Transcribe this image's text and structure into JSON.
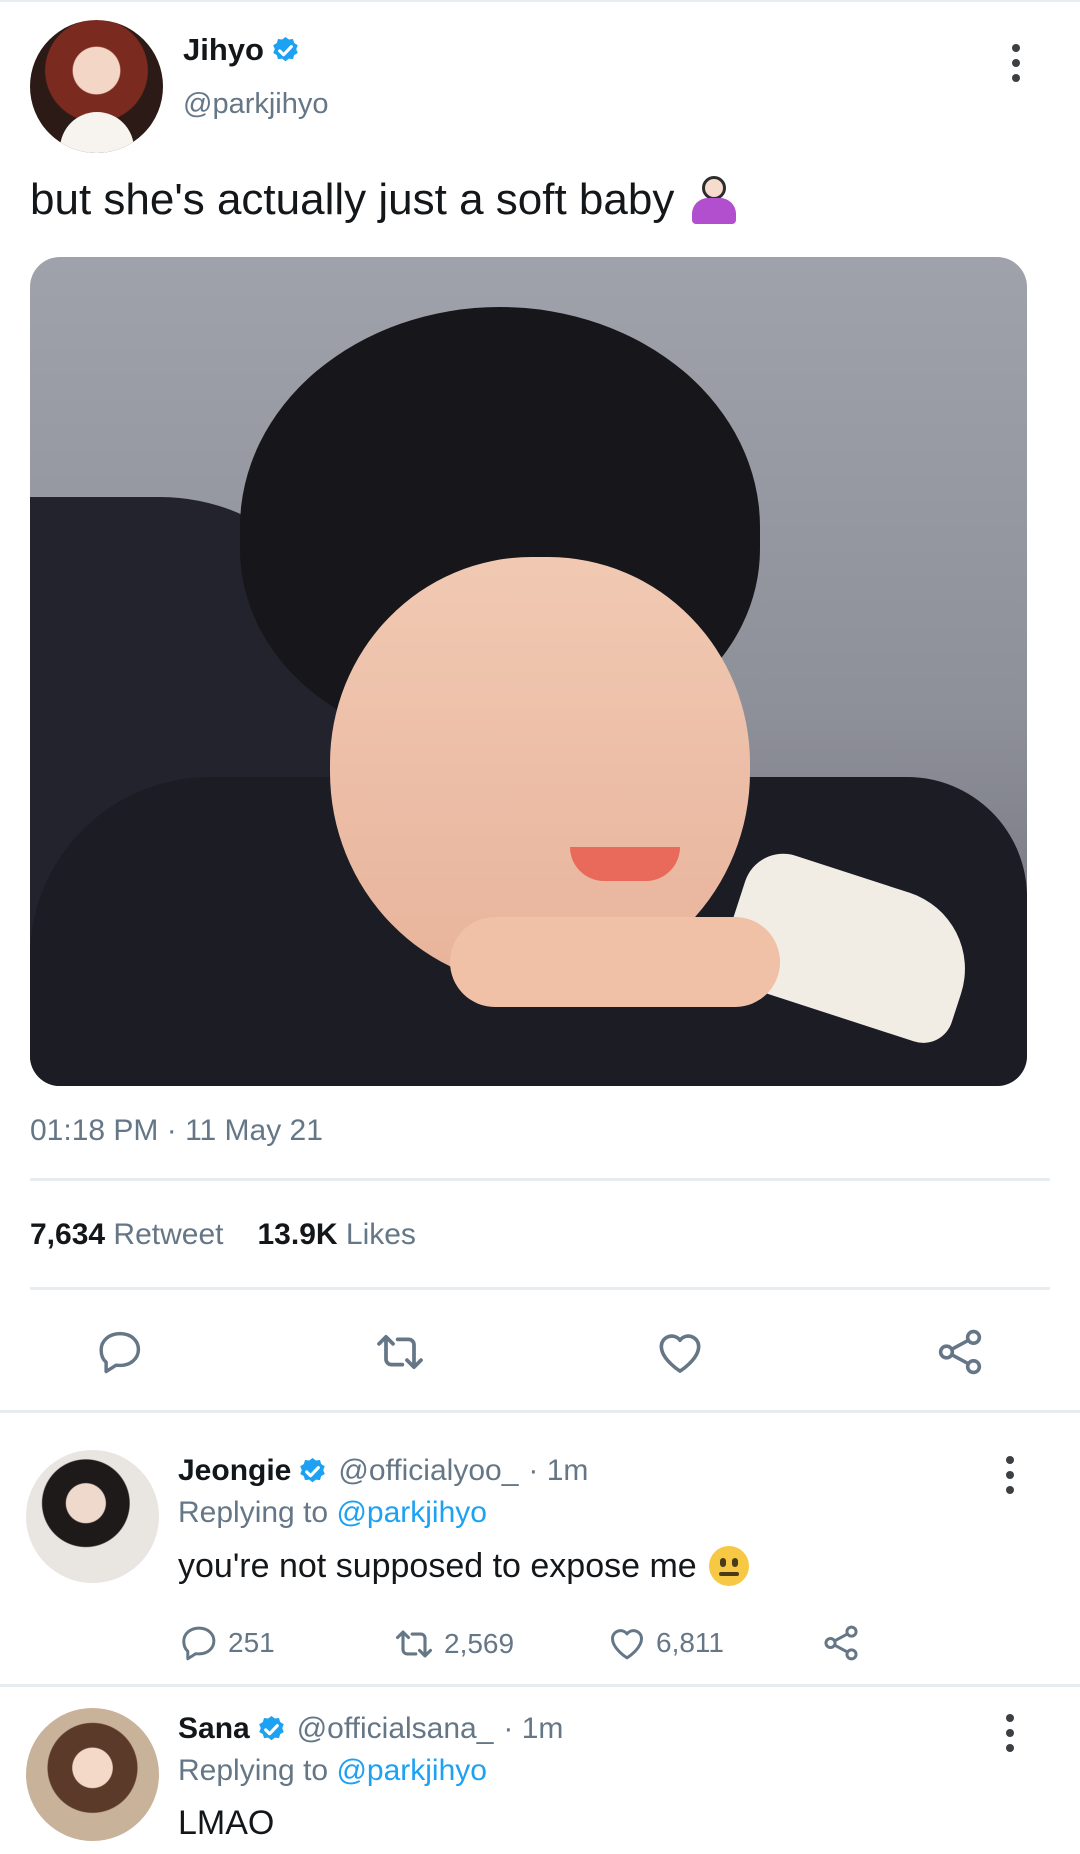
{
  "tweet": {
    "author_name": "Jihyo",
    "author_handle": "@parkjihyo",
    "text": "but she's actually just a soft baby",
    "emoji_icon": "person-shrugging-icon",
    "timestamp": "01:18 PM · 11 May 21",
    "retweet_count": "7,634",
    "retweet_label": "Retweet",
    "like_count": "13.9K",
    "like_label": "Likes"
  },
  "replies": [
    {
      "author_name": "Jeongie",
      "author_handle": "@officialyoo_",
      "time": "· 1m",
      "replying_prefix": "Replying to",
      "replying_to": "@parkjihyo",
      "text": "you're not supposed to expose me",
      "emoji_icon": "neutral-face-icon",
      "reply_count": "251",
      "retweet_count": "2,569",
      "like_count": "6,811"
    },
    {
      "author_name": "Sana",
      "author_handle": "@officialsana_",
      "time": "· 1m",
      "replying_prefix": "Replying to",
      "replying_to": "@parkjihyo",
      "text": "LMAO"
    }
  ],
  "colors": {
    "accent": "#1da1f2",
    "text_primary": "#14171a",
    "text_secondary": "#657786",
    "divider": "#e6ecf0"
  }
}
